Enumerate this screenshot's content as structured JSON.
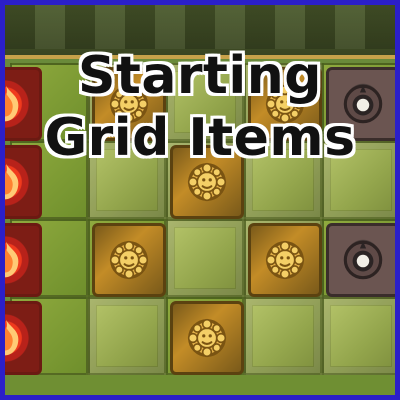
{
  "title": {
    "line1": "Starting",
    "line2": "Grid Items"
  },
  "items": {
    "fire": "fire-tile",
    "gold": "gold-sun-tile",
    "dark": "dark-orb-tile"
  },
  "colors": {
    "border": "#2b1fc9",
    "fire": "#f03a1d",
    "gold": "#c38c27",
    "dark": "#6b5551",
    "board": "#6f8f33"
  }
}
